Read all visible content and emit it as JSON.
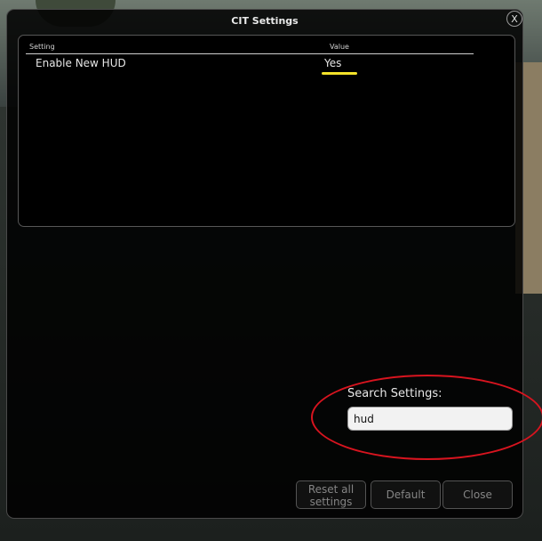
{
  "window": {
    "title": "CIT Settings",
    "close_glyph": "X"
  },
  "grid": {
    "columns": [
      "Setting",
      "Value"
    ],
    "rows": [
      {
        "setting": "Enable New HUD",
        "value": "Yes"
      }
    ]
  },
  "search": {
    "label": "Search Settings:",
    "value": "hud"
  },
  "buttons": {
    "reset_line1": "Reset all",
    "reset_line2": "settings",
    "default": "Default",
    "close": "Close"
  },
  "colors": {
    "highlight_underline": "#f3e22a",
    "annotation_circle": "#d8141f"
  }
}
